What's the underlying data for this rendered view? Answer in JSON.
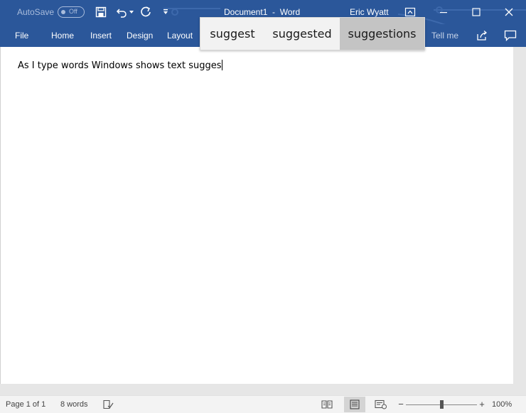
{
  "title_bar": {
    "autosave_label": "AutoSave",
    "autosave_state": "Off",
    "document_title": "Document1  -  Word",
    "user_name": "Eric Wyatt"
  },
  "ribbon": {
    "tabs": [
      "File",
      "Home",
      "Insert",
      "Design",
      "Layout"
    ],
    "tell_me": "Tell me"
  },
  "suggestions": [
    "suggest",
    "suggested",
    "suggestions"
  ],
  "document": {
    "text": "As I type words Windows shows text sugges"
  },
  "status_bar": {
    "page_info": "Page 1 of 1",
    "word_count": "8 words",
    "zoom": "100%"
  },
  "colors": {
    "ribbon_blue": "#2b579a",
    "suggestion_highlight": "#c4c4c4"
  }
}
